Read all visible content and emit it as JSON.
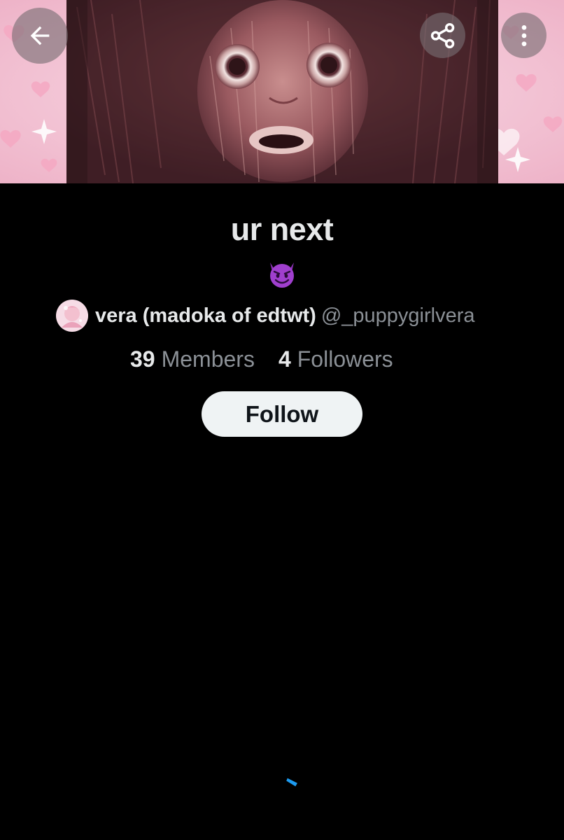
{
  "list": {
    "title": "ur next",
    "emoji": "devil-face-icon",
    "owner": {
      "display_name": "vera (madoka of edtwt)",
      "handle": "@_puppygirlvera"
    },
    "stats": {
      "members_count": "39",
      "members_label": "Members",
      "followers_count": "4",
      "followers_label": "Followers"
    },
    "follow_label": "Follow"
  },
  "header": {
    "back_icon": "back-arrow-icon",
    "share_icon": "share-icon",
    "more_icon": "more-vertical-icon"
  },
  "colors": {
    "background": "#000000",
    "primary_text": "#e7e9ea",
    "secondary_text": "#8b9096",
    "follow_button_bg": "#eff3f4",
    "spinner": "#1d9bf0",
    "banner_pink": "#f3c6d6"
  },
  "loading": {
    "spinner_icon": "loading-spinner-icon"
  }
}
